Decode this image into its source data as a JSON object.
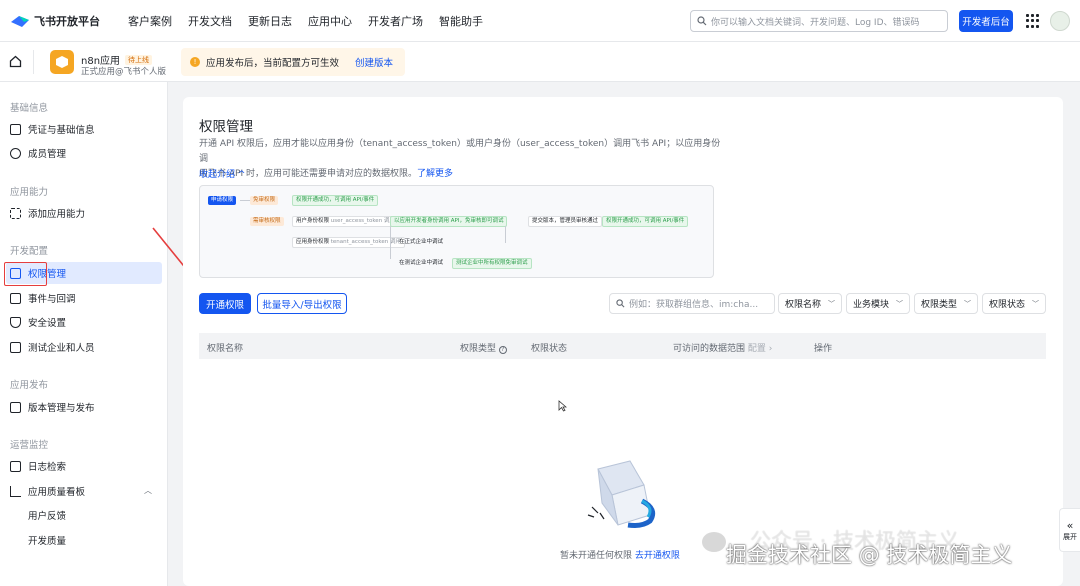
{
  "header": {
    "brand": "飞书开放平台",
    "nav": [
      "客户案例",
      "开发文档",
      "更新日志",
      "应用中心",
      "开发者广场",
      "智能助手"
    ],
    "search_placeholder": "你可以输入文档关键词、开发问题、Log ID、错误码",
    "dev_console": "开发者后台"
  },
  "app": {
    "name": "n8n应用",
    "status_badge": "待上线",
    "subtitle": "正式应用@飞书个人版",
    "notice": "应用发布后，当前配置方可生效",
    "notice_link": "创建版本"
  },
  "sidebar": {
    "sections": [
      {
        "title": "基础信息",
        "items": [
          {
            "label": "凭证与基础信息",
            "icon": "id-card-icon"
          },
          {
            "label": "成员管理",
            "icon": "user-icon"
          }
        ]
      },
      {
        "title": "应用能力",
        "items": [
          {
            "label": "添加应用能力",
            "icon": "grid-plus-icon"
          }
        ]
      },
      {
        "title": "开发配置",
        "items": [
          {
            "label": "权限管理",
            "icon": "lock-icon",
            "active": true
          },
          {
            "label": "事件与回调",
            "icon": "plus-box-icon"
          },
          {
            "label": "安全设置",
            "icon": "shield-icon"
          },
          {
            "label": "测试企业和人员",
            "icon": "code-icon"
          }
        ]
      },
      {
        "title": "应用发布",
        "items": [
          {
            "label": "版本管理与发布",
            "icon": "upload-icon"
          }
        ]
      },
      {
        "title": "运营监控",
        "items": [
          {
            "label": "日志检索",
            "icon": "log-icon"
          },
          {
            "label": "应用质量看板",
            "icon": "chart-icon"
          },
          {
            "label": "用户反馈",
            "icon": ""
          },
          {
            "label": "开发质量",
            "icon": ""
          }
        ]
      }
    ]
  },
  "page": {
    "title": "权限管理",
    "desc_1": "开通 API 权限后，应用才能以应用身份（tenant_access_token）或用户身份（user_access_token）调用飞书 API；以应用身份调",
    "desc_2": "用飞书 API 时，应用可能还需要申请对应的数据权限。",
    "learn_more": "了解更多",
    "collapse": "收起介绍",
    "flow": {
      "apply": "申请权限",
      "no_review": "免审权限",
      "opened_1": "权限开通成功，可调用 API/事件",
      "need_review": "需审核权限",
      "user_scope": "用户身份权限",
      "user_scope_note": "user_access_token 调用",
      "dev_call": "以应用开发者身份调用 API，免审核即可调试",
      "submit": "提交版本，管理员审核通过",
      "opened_2": "权限开通成功，可调用 API/事件",
      "app_scope": "应用身份权限",
      "app_scope_note": "tenant_access_token 调用",
      "prod_apply": "在正式企业中调试",
      "test_apply": "在测试企业中调试",
      "test_free": "测试企业中所有权限免审调试"
    },
    "open_btn": "开通权限",
    "batch_btn": "批量导入/导出权限",
    "filter_placeholder": "例如：获取群组信息、im:cha...",
    "filters": [
      "权限名称",
      "业务模块",
      "权限类型",
      "权限状态"
    ],
    "columns": [
      "权限名称",
      "权限类型",
      "权限状态",
      "可访问的数据范围",
      "配置",
      "操作"
    ],
    "empty_text": "暂未开通任何权限",
    "empty_link": "去开通权限"
  },
  "watermark": {
    "line1": "公众号 · 技术极简主义",
    "line2": "掘金技术社区 @ 技术极简主义"
  },
  "edge_btn": "展开"
}
